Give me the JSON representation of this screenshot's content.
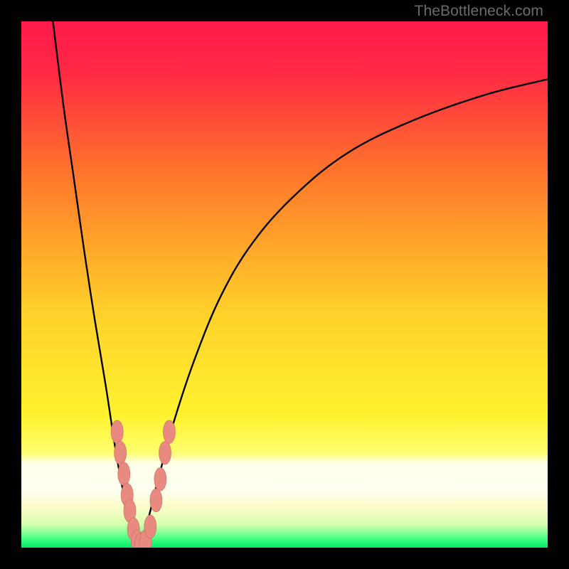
{
  "watermark": "TheBottleneck.com",
  "colors": {
    "top": "#ff1a4b",
    "mid_upper": "#ff6a2a",
    "mid": "#ffe12a",
    "lower_yellow": "#fff99a",
    "green_light": "#b9ff8c",
    "green": "#2fff7a",
    "green_deep": "#00e865",
    "curve": "#000000",
    "marker_fill": "#e98a80",
    "marker_stroke": "#c96b62"
  },
  "chart_data": {
    "type": "line",
    "title": "",
    "xlabel": "",
    "ylabel": "",
    "xlim": [
      0,
      100
    ],
    "ylim": [
      0,
      100
    ],
    "series": [
      {
        "name": "left-branch",
        "x": [
          6,
          8,
          10,
          12,
          14,
          16,
          18,
          19.5,
          21,
          22.5
        ],
        "y": [
          100,
          84,
          70,
          56,
          43,
          31,
          18,
          10,
          4,
          0
        ]
      },
      {
        "name": "right-branch",
        "x": [
          22.5,
          24,
          26,
          29,
          33,
          38,
          44,
          52,
          62,
          74,
          88,
          100
        ],
        "y": [
          0,
          5,
          13,
          24,
          36,
          48,
          58,
          67,
          75,
          81,
          86,
          89
        ]
      }
    ],
    "markers": [
      {
        "x": 18.2,
        "y": 22,
        "r": 2.1
      },
      {
        "x": 18.8,
        "y": 18,
        "r": 2.1
      },
      {
        "x": 19.5,
        "y": 14,
        "r": 2.1
      },
      {
        "x": 20.1,
        "y": 10,
        "r": 2.1
      },
      {
        "x": 20.6,
        "y": 7,
        "r": 2.1
      },
      {
        "x": 21.3,
        "y": 3.5,
        "r": 2.1
      },
      {
        "x": 22.0,
        "y": 1.2,
        "r": 2.1
      },
      {
        "x": 22.7,
        "y": 0.6,
        "r": 2.1
      },
      {
        "x": 23.6,
        "y": 1.2,
        "r": 2.1
      },
      {
        "x": 24.5,
        "y": 4,
        "r": 2.1
      },
      {
        "x": 25.6,
        "y": 9,
        "r": 2.1
      },
      {
        "x": 26.4,
        "y": 13,
        "r": 2.1
      },
      {
        "x": 27.3,
        "y": 18,
        "r": 2.1
      },
      {
        "x": 28.1,
        "y": 22,
        "r": 2.1
      }
    ],
    "green_band": {
      "y_from": 0,
      "y_to": 4
    }
  }
}
